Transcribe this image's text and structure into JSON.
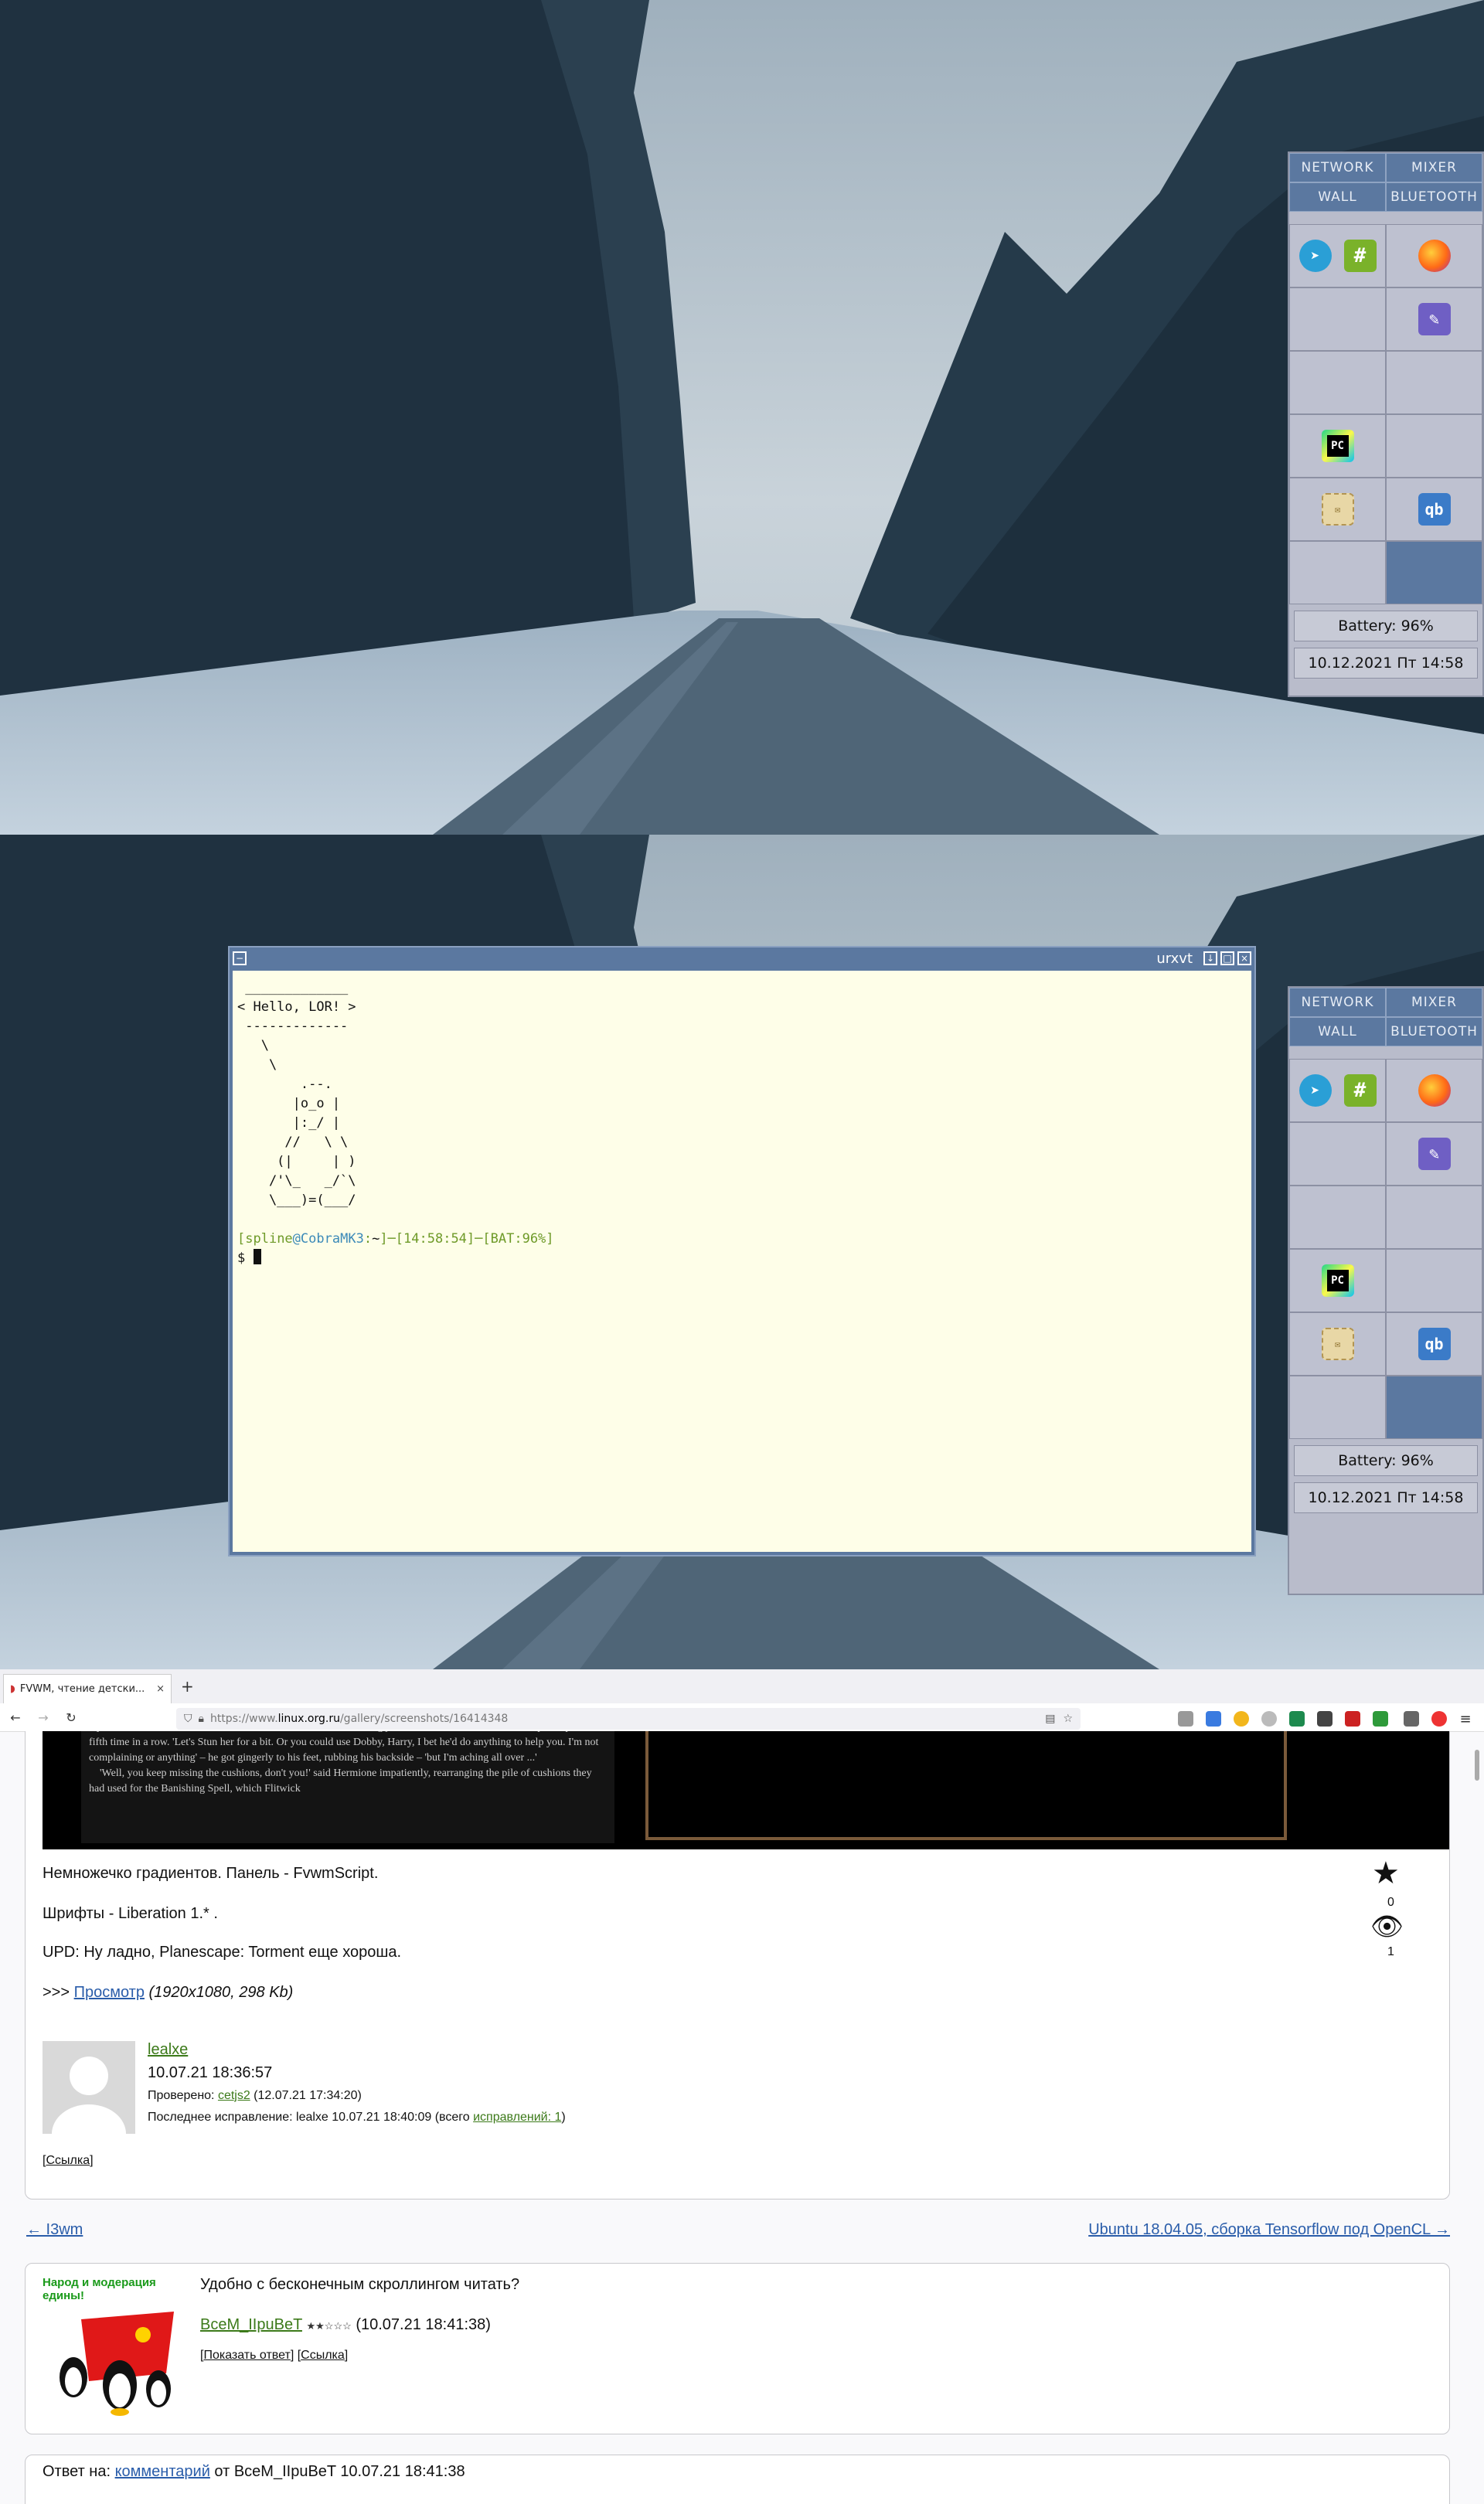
{
  "panel": {
    "tabs": [
      "NETWORK",
      "MIXER",
      "WALL",
      "BLUETOOTH"
    ],
    "icons": {
      "row1_left": [
        "telegram-icon",
        "hexchat-icon"
      ],
      "row1_right": "firefox-icon",
      "row2_left": "terminal-icon",
      "row2_right": "editor-icon",
      "row3_right": "terminal-icon",
      "row4_left": "pycharm-icon",
      "row5_left": "mail-icon",
      "row5_right": "qbittorrent-icon"
    },
    "pycharm_label": "PC",
    "battery": "Battery: 96%",
    "datetime": "10.12.2021 Пт 14:58"
  },
  "terminal": {
    "title": "urxvt",
    "cowsay": " _____________\n< Hello, LOR! >\n -------------\n   \\\n    \\\n        .--.\n       |o_o |\n       |:_/ |\n      //   \\ \\\n     (|     | )\n    /'\\_   _/`\\\n    \\___)=(___/",
    "prompt_user": "spline",
    "prompt_host": "CobraMK3",
    "prompt_path": "~",
    "prompt_time": "14:58:54",
    "prompt_bat": "BAT:96%",
    "prompt_char": "$"
  },
  "browser": {
    "tab_title": "FVWM, чтение детски...",
    "tab_close": "×",
    "new_tab": "+",
    "url_prefix": "https://www.",
    "url_host": "linux.org.ru",
    "url_path": "/gallery/screenshots/16414348",
    "book_text": "lay flat on his back in the middle of their Charms classroom, having just been Stunned and re-awoken by Harry for the fifth time in a row. 'Let's Stun her for a bit. Or you could use Dobby, Harry, I bet he'd do anything to help you. I'm not complaining or anything' – he got gingerly to his feet, rubbing his backside – 'but I'm aching all over ...'\n    'Well, you keep missing the cushions, don't you!' said Hermione impatiently, rearranging the pile of cushions they had used for the Banishing Spell, which Flitwick",
    "post": {
      "line1": "Немножечко градиентов. Панель - FvwmScript.",
      "line2": "Шрифты - Liberation 1.* .",
      "line3": "UPD: Ну ладно, Planescape: Torment еще хороша.",
      "view_prefix": ">>> ",
      "view_link": "Просмотр",
      "view_meta": "(1920x1080, 298 Kb)",
      "stars": "0",
      "views": "1",
      "author": "lealxe",
      "date": "10.07.21 18:36:57",
      "checked_prefix": "Проверено: ",
      "checked_by": "cetjs2",
      "checked_date": " (12.07.21 17:34:20)",
      "edit_prefix": "Последнее исправление: lealxe 10.07.21 18:40:09 (всего ",
      "edit_link": "исправлений: 1",
      "edit_suffix": ")",
      "link": "Ссылка"
    },
    "nav": {
      "prev": "← I3wm",
      "next": "Ubuntu 18.04.05, сборка Tensorflow под OpenCL →"
    },
    "comment": {
      "banner_line1": "Народ и модерация",
      "banner_line2": "едины!",
      "text": "Удобно с бесконечным скроллингом читать?",
      "author": "ВсеМ_IIpuBeT",
      "stars": "★★☆☆☆",
      "date": "(10.07.21 18:41:38)",
      "show_answer": "Показать ответ",
      "link": "Ссылка"
    },
    "reply": {
      "prefix": "Ответ на: ",
      "link": "комментарий",
      "suffix": " от ВсеМ_IIpuBeT 10.07.21 18:41:38"
    }
  }
}
